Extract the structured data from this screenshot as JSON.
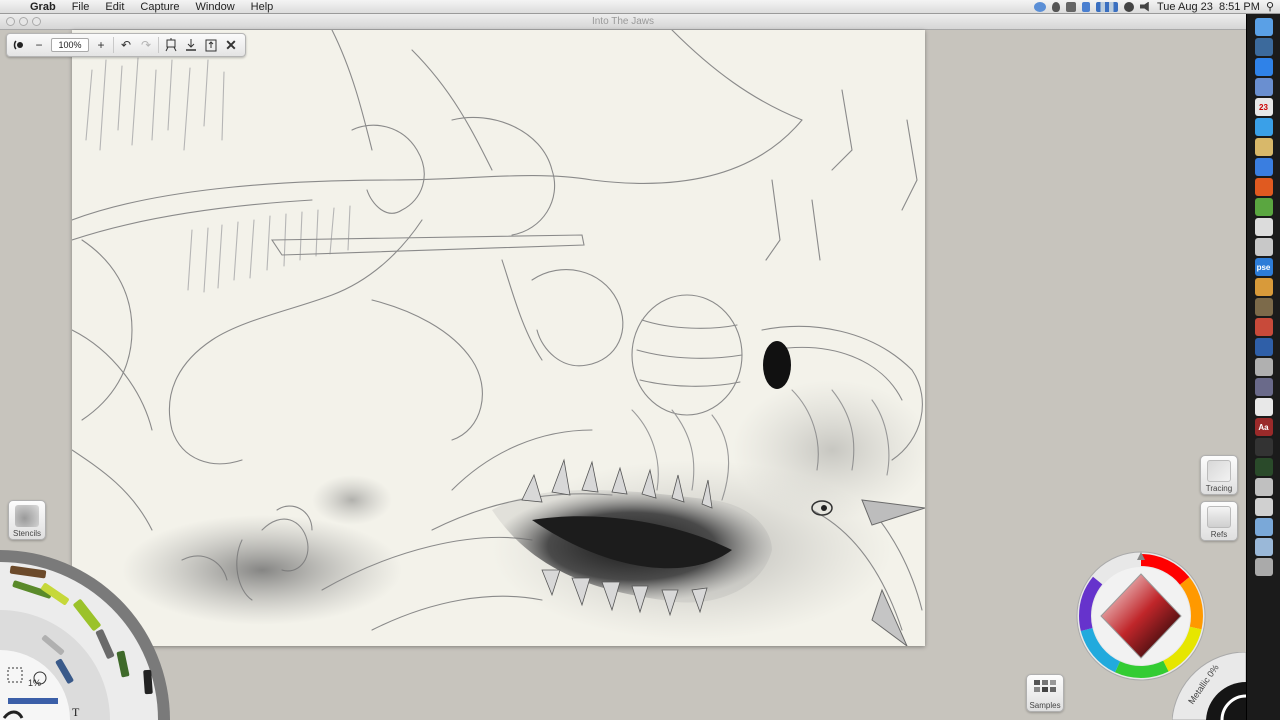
{
  "menubar": {
    "apple_glyph": "",
    "app_name": "Grab",
    "items": [
      "File",
      "Edit",
      "Capture",
      "Window",
      "Help"
    ],
    "clock": "Tue Aug 23  8:51 PM",
    "status_icons": [
      "sync-icon",
      "flame-icon",
      "monitor-icon",
      "bluetooth-icon",
      "activity-graph-icon",
      "time-machine-icon",
      "volume-icon"
    ],
    "search_glyph": "⚲"
  },
  "window": {
    "title": "Into The Jaws"
  },
  "toolbar": {
    "zoom_value": "100%",
    "minus_label": "−",
    "plus_label": "+",
    "undo_glyph": "↶",
    "redo_glyph": "↷",
    "close_glyph": "✕"
  },
  "panels": {
    "stencils_label": "Stencils",
    "tracing_label": "Tracing",
    "refs_label": "Refs",
    "samples_label": "Samples"
  },
  "tools": {
    "opacity_readout": "1%",
    "text_tool_glyph": "T",
    "metallic_label": "Metallic 0%"
  },
  "colors": {
    "current_color": "#8c1e1e",
    "canvas_paper": "#f3f2ea",
    "ui_background": "#c7c4bd"
  },
  "dock": {
    "icons": [
      {
        "name": "finder-icon",
        "color": "#5aa0e6"
      },
      {
        "name": "mission-control-icon",
        "color": "#3c6a9c"
      },
      {
        "name": "app-store-icon",
        "color": "#2f82e8"
      },
      {
        "name": "preview-icon",
        "color": "#6a8fd0"
      },
      {
        "name": "calendar-icon",
        "color": "#e8e8e8",
        "glyph": "23"
      },
      {
        "name": "safari-icon",
        "color": "#3aa0e8"
      },
      {
        "name": "notes-icon",
        "color": "#d8b86a"
      },
      {
        "name": "itunes-icon",
        "color": "#3a7ee0"
      },
      {
        "name": "artrage-icon",
        "color": "#e05a20"
      },
      {
        "name": "evernote-icon",
        "color": "#5aa640"
      },
      {
        "name": "textedit-icon",
        "color": "#dcdcdc"
      },
      {
        "name": "script-icon",
        "color": "#c8c8c8"
      },
      {
        "name": "photoshop-elements-icon",
        "color": "#2d7cd8",
        "glyph": "pse"
      },
      {
        "name": "iphoto-icon",
        "color": "#d89a3a"
      },
      {
        "name": "imovie-icon",
        "color": "#7c6a4a"
      },
      {
        "name": "photo-booth-icon",
        "color": "#c84a3a"
      },
      {
        "name": "virtualbox-icon",
        "color": "#2f5fa8"
      },
      {
        "name": "image-capture-icon",
        "color": "#b0b0b0"
      },
      {
        "name": "instruments-icon",
        "color": "#6a6a8a"
      },
      {
        "name": "stickies-icon",
        "color": "#e8e8e8"
      },
      {
        "name": "dictionary-icon",
        "color": "#9a2a2a",
        "glyph": "Aa"
      },
      {
        "name": "terminal-icon",
        "color": "#333333"
      },
      {
        "name": "activity-monitor-icon",
        "color": "#2a4a2a"
      },
      {
        "name": "grab-icon",
        "color": "#c0c0c0"
      },
      {
        "name": "printer-icon",
        "color": "#d0d0d0"
      },
      {
        "name": "applications-folder-icon",
        "color": "#7aa8d8"
      },
      {
        "name": "documents-folder-icon",
        "color": "#9ab8d8"
      },
      {
        "name": "trash-icon",
        "color": "#aaaaaa"
      }
    ]
  }
}
